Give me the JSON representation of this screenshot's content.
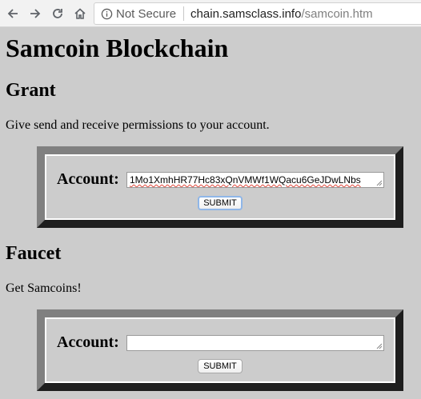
{
  "browser": {
    "security_label": "Not Secure",
    "url_host": "chain.samsclass.info",
    "url_path": "/samcoin.htm"
  },
  "page": {
    "title": "Samcoin Blockchain"
  },
  "grant": {
    "heading": "Grant",
    "description": "Give send and receive permissions to your account.",
    "account_label": "Account:",
    "account_value": "1Mo1XmhHR77Hc83xQnVMWf1WQacu6GeJDwLNbs",
    "submit_label": "SUBMIT"
  },
  "faucet": {
    "heading": "Faucet",
    "description": "Get Samcoins!",
    "account_label": "Account:",
    "account_value": "",
    "submit_label": "SUBMIT"
  }
}
